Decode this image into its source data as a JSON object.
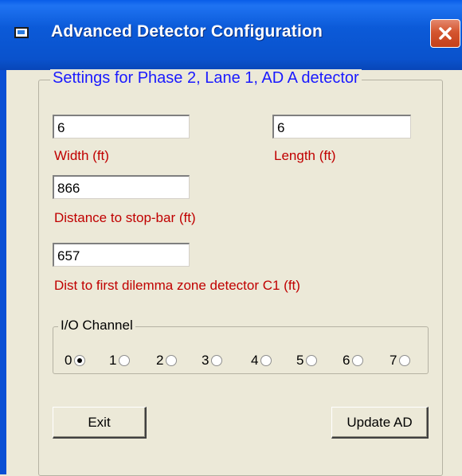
{
  "window": {
    "title": "Advanced Detector Configuration",
    "app_icon": "app-window-icon",
    "close_icon": "close-icon"
  },
  "settings": {
    "legend": "Settings for Phase 2, Lane 1, AD A detector",
    "width": {
      "value": "6",
      "label": "Width (ft)"
    },
    "length": {
      "value": "6",
      "label": "Length (ft)"
    },
    "distance": {
      "value": "866",
      "label": "Distance to stop-bar (ft)"
    },
    "dilemma": {
      "value": "657",
      "label": "Dist to first dilemma zone detector C1 (ft)"
    }
  },
  "io_channel": {
    "legend": "I/O Channel",
    "options": [
      "0",
      "1",
      "2",
      "3",
      "4",
      "5",
      "6",
      "7"
    ],
    "selected": "0"
  },
  "buttons": {
    "exit": "Exit",
    "update": "Update AD"
  },
  "colors": {
    "titlebar": "#0a5ee8",
    "legend_blue": "#1a1aff",
    "label_red": "#c00000",
    "background": "#ece9d8"
  }
}
